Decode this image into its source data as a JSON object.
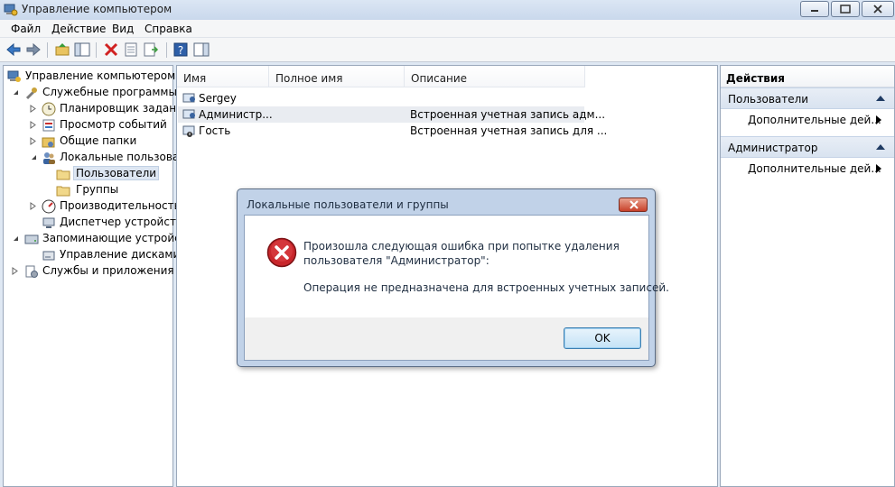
{
  "window": {
    "title": "Управление компьютером"
  },
  "menu": [
    "Файл",
    "Действие",
    "Вид",
    "Справка"
  ],
  "tree": {
    "root": "Управление компьютером (л",
    "items": [
      {
        "label": "Служебные программы"
      },
      {
        "label": "Планировщик заданий"
      },
      {
        "label": "Просмотр событий"
      },
      {
        "label": "Общие папки"
      },
      {
        "label": "Локальные пользовате"
      },
      {
        "label": "Пользователи"
      },
      {
        "label": "Группы"
      },
      {
        "label": "Производительность"
      },
      {
        "label": "Диспетчер устройств"
      },
      {
        "label": "Запоминающие устройст"
      },
      {
        "label": "Управление дисками"
      },
      {
        "label": "Службы и приложения"
      }
    ]
  },
  "list": {
    "columns": [
      "Имя",
      "Полное имя",
      "Описание"
    ],
    "rows": [
      {
        "name": "Sergey",
        "full_name": "",
        "description": ""
      },
      {
        "name": "Администр...",
        "full_name": "",
        "description": "Встроенная учетная запись адм..."
      },
      {
        "name": "Гость",
        "full_name": "",
        "description": "Встроенная учетная запись для ..."
      }
    ]
  },
  "actions": {
    "title": "Действия",
    "sections": [
      {
        "header": "Пользователи",
        "item": "Дополнительные дей..."
      },
      {
        "header": "Администратор",
        "item": "Дополнительные дей..."
      }
    ]
  },
  "dialog": {
    "title": "Локальные пользователи и группы",
    "message_line1": "Произошла следующая ошибка при попытке удаления",
    "message_line2": "пользователя \"Администратор\":",
    "message_detail": "Операция не предназначена для встроенных учетных записей.",
    "ok_label": "OK"
  },
  "colors": {
    "error_red": "#c8262b",
    "selection": "#dde6f2",
    "accent": "#3c7fb1"
  }
}
